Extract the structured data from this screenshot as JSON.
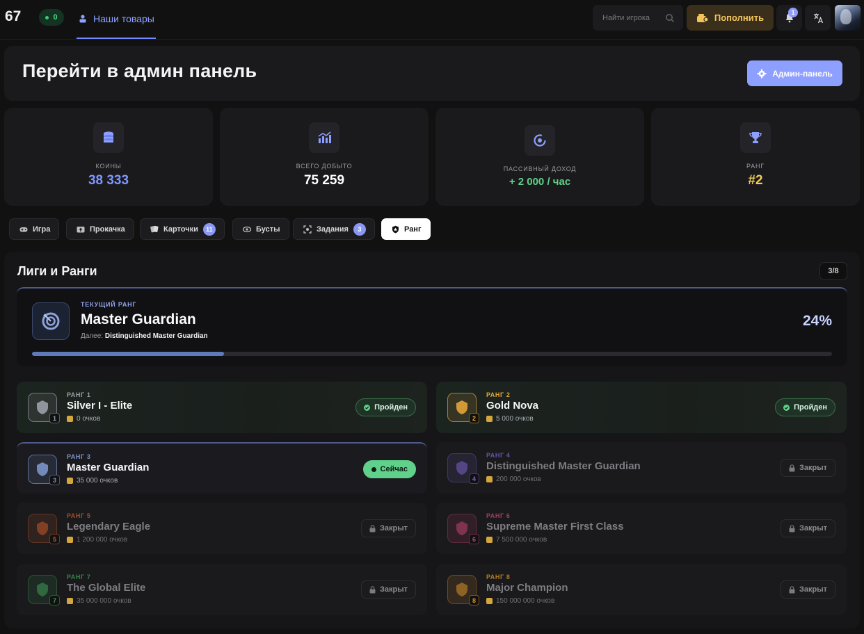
{
  "header": {
    "logo": "67",
    "online_count": "0",
    "nav_tab": "Наши товары",
    "search_placeholder": "Найти игрока",
    "topup_label": "Пополнить",
    "notifications_count": "1"
  },
  "admin": {
    "title": "Перейти в админ панель",
    "button_label": "Админ-панель"
  },
  "stats": [
    {
      "label": "КОИНЫ",
      "value": "38 333",
      "color": "#7f96ff",
      "icon": "coins-icon"
    },
    {
      "label": "ВСЕГО ДОБЫТО",
      "value": "75 259",
      "color": "#ffffff",
      "icon": "chart-icon"
    },
    {
      "label": "ПАССИВНЫЙ ДОХОД",
      "value": "+ 2 000 / час",
      "color": "#5fd18a",
      "icon": "passive-income-icon"
    },
    {
      "label": "РАНГ",
      "value": "#2",
      "color": "#f1cd55",
      "icon": "trophy-icon"
    }
  ],
  "tabs": [
    {
      "label": "Игра",
      "icon": "gamepad-icon"
    },
    {
      "label": "Прокачка",
      "icon": "upgrade-icon"
    },
    {
      "label": "Карточки",
      "icon": "cards-icon",
      "count": "11"
    },
    {
      "label": "Бусты",
      "icon": "boost-icon"
    },
    {
      "label": "Задания",
      "icon": "tasks-icon",
      "count": "3"
    },
    {
      "label": "Ранг",
      "icon": "shield-icon",
      "active": true
    }
  ],
  "leagues": {
    "title": "Лиги и Ранги",
    "progress_count": "3/8",
    "current": {
      "kicker": "ТЕКУЩИЙ РАНГ",
      "name": "Master Guardian",
      "next_prefix": "Далее:",
      "next_name": "Distinguished Master Guardian",
      "percent": "24%",
      "progress": 0.24
    },
    "ranks": [
      {
        "kicker": "РАНГ 1",
        "name": "Silver I - Elite",
        "points": "0 очков",
        "num": "1",
        "status": "Пройден",
        "state": "passed",
        "accent": "#9aa0a8"
      },
      {
        "kicker": "РАНГ 2",
        "name": "Gold Nova",
        "points": "5 000 очков",
        "num": "2",
        "status": "Пройден",
        "state": "passed",
        "accent": "#e2a53a"
      },
      {
        "kicker": "РАНГ 3",
        "name": "Master Guardian",
        "points": "35 000 очков",
        "num": "3",
        "status": "Сейчас",
        "state": "now",
        "accent": "#7b93c8"
      },
      {
        "kicker": "РАНГ 4",
        "name": "Distinguished Master Guardian",
        "points": "200 000 очков",
        "num": "4",
        "status": "Закрыт",
        "state": "locked",
        "accent": "#7a62c9"
      },
      {
        "kicker": "РАНГ 5",
        "name": "Legendary Eagle",
        "points": "1 200 000 очков",
        "num": "5",
        "status": "Закрыт",
        "state": "locked",
        "accent": "#c25a2a"
      },
      {
        "kicker": "РАНГ 6",
        "name": "Supreme Master First Class",
        "points": "7 500 000 очков",
        "num": "6",
        "status": "Закрыт",
        "state": "locked",
        "accent": "#c0466e"
      },
      {
        "kicker": "РАНГ 7",
        "name": "The Global Elite",
        "points": "35 000 000 очков",
        "num": "7",
        "status": "Закрыт",
        "state": "locked",
        "accent": "#3f9b58"
      },
      {
        "kicker": "РАНГ 8",
        "name": "Major Champion",
        "points": "150 000 000 очков",
        "num": "8",
        "status": "Закрыт",
        "state": "locked",
        "accent": "#d8922c"
      }
    ]
  }
}
